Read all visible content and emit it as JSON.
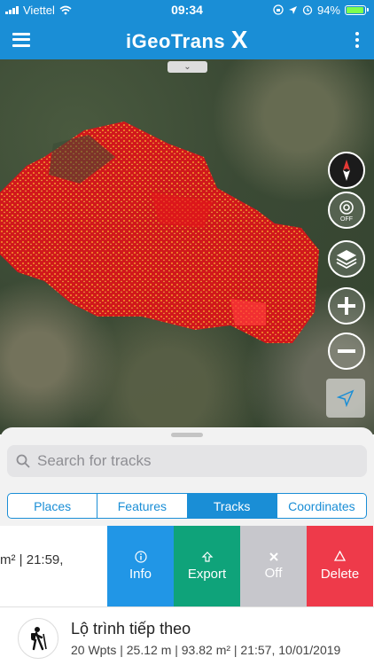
{
  "status": {
    "carrier": "Viettel",
    "time": "09:34",
    "battery": "94%",
    "battery_level": 0.94
  },
  "nav": {
    "title_main": "iGeoTrans ",
    "title_x": "X"
  },
  "search": {
    "placeholder": "Search for tracks"
  },
  "tabs": [
    {
      "label": "Places",
      "active": false
    },
    {
      "label": "Features",
      "active": false
    },
    {
      "label": "Tracks",
      "active": true
    },
    {
      "label": "Coordinates",
      "active": false
    }
  ],
  "row1": {
    "peek_text": "m² | 21:59,",
    "actions": [
      {
        "label": "Info",
        "icon": "info-icon",
        "color": "#2196e6"
      },
      {
        "label": "Export",
        "icon": "upload-icon",
        "color": "#0fa37a"
      },
      {
        "label": "Off",
        "icon": "close-icon",
        "color": "#c7c7cc"
      },
      {
        "label": "Delete",
        "icon": "recycle-icon",
        "color": "#ee3a4a"
      }
    ]
  },
  "row2": {
    "name": "Lộ trình tiếp theo",
    "meta": "20 Wpts | 25.12 m | 93.82 m² | 21:57, 10/01/2019",
    "icon": "hiker-icon"
  },
  "map_buttons": {
    "gps_off_label": "OFF"
  },
  "colors": {
    "brand": "#1a8ed6",
    "heat": "#e4161b"
  }
}
